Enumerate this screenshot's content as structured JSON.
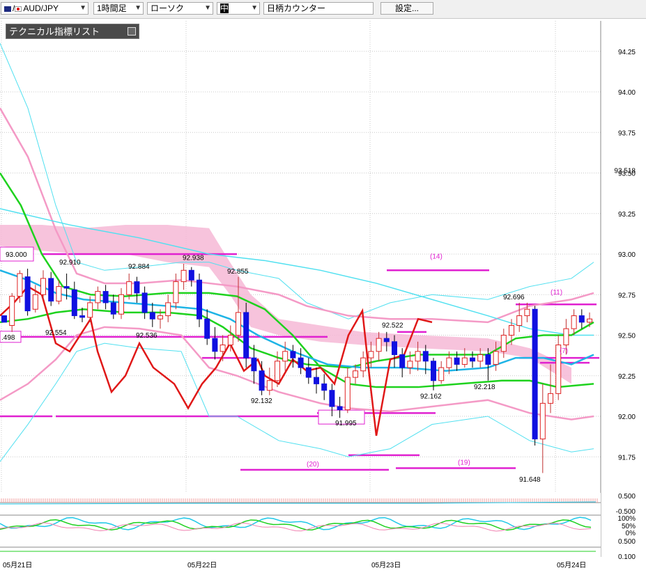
{
  "toolbar": {
    "symbol": "AUD/JPY",
    "timeframe": "1時間足",
    "chart_type": "ローソク",
    "style": "中",
    "counter_placeholder": "日柄カウンター",
    "settings_label": "設定..."
  },
  "indicator_panel": {
    "label": "テクニカル指標リスト"
  },
  "colors": {
    "bull_candle": "#e02020",
    "bear_candle": "#1010e0",
    "ichimoku_cloud": "#f6b8d6",
    "bollinger_inner": "#f49ac6",
    "bollinger_outer": "#50e0f0",
    "moving_average_green": "#1ed21e",
    "moving_average_blue": "#1eb4e6",
    "red_line": "#e01818",
    "support_resistance": "#e020d0"
  },
  "chart_data": {
    "type": "candlestick",
    "ylim": [
      91.55,
      94.32
    ],
    "y_ticks": [
      "94.25",
      "94.00",
      "93.75",
      "93.50",
      "93.25",
      "93.00",
      "92.75",
      "92.50",
      "92.25",
      "92.00",
      "91.75"
    ],
    "current_price_label": "93.518",
    "x_ticks": [
      "05月21日",
      "05月22日",
      "05月23日",
      "05月24日"
    ],
    "candles": [
      [
        92.62,
        92.58,
        92.55,
        92.55
      ],
      [
        92.56,
        92.74,
        92.76,
        92.52
      ],
      [
        92.74,
        92.88,
        92.9,
        92.7
      ],
      [
        92.86,
        92.65,
        92.91,
        92.62
      ],
      [
        92.66,
        92.75,
        92.81,
        92.64
      ],
      [
        92.75,
        92.85,
        92.9,
        92.72
      ],
      [
        92.85,
        92.71,
        92.89,
        92.68
      ],
      [
        92.71,
        92.8,
        92.84,
        92.69
      ],
      [
        92.8,
        92.79,
        92.88,
        92.72
      ],
      [
        92.78,
        92.62,
        92.83,
        92.6
      ],
      [
        92.62,
        92.61,
        92.67,
        92.58
      ],
      [
        92.61,
        92.7,
        92.74,
        92.58
      ],
      [
        92.7,
        92.77,
        92.8,
        92.66
      ],
      [
        92.77,
        92.7,
        92.81,
        92.66
      ],
      [
        92.7,
        92.63,
        92.75,
        92.6
      ],
      [
        92.63,
        92.75,
        92.79,
        92.6
      ],
      [
        92.75,
        92.83,
        92.88,
        92.72
      ],
      [
        92.83,
        92.76,
        92.86,
        92.7
      ],
      [
        92.76,
        92.64,
        92.8,
        92.6
      ],
      [
        92.64,
        92.6,
        92.7,
        92.55
      ],
      [
        92.6,
        92.62,
        92.66,
        92.54
      ],
      [
        92.62,
        92.7,
        92.75,
        92.58
      ],
      [
        92.7,
        92.83,
        92.88,
        92.66
      ],
      [
        92.83,
        92.9,
        92.94,
        92.78
      ],
      [
        92.9,
        92.84,
        92.92,
        92.8
      ],
      [
        92.84,
        92.6,
        92.88,
        92.55
      ],
      [
        92.6,
        92.48,
        92.66,
        92.44
      ],
      [
        92.48,
        92.4,
        92.55,
        92.35
      ],
      [
        92.4,
        92.44,
        92.5,
        92.34
      ],
      [
        92.44,
        92.5,
        92.56,
        92.4
      ],
      [
        92.5,
        92.64,
        92.86,
        92.46
      ],
      [
        92.64,
        92.36,
        92.7,
        92.3
      ],
      [
        92.36,
        92.28,
        92.44,
        92.2
      ],
      [
        92.28,
        92.16,
        92.34,
        92.13
      ],
      [
        92.16,
        92.22,
        92.3,
        92.13
      ],
      [
        92.22,
        92.34,
        92.4,
        92.18
      ],
      [
        92.34,
        92.4,
        92.46,
        92.28
      ],
      [
        92.4,
        92.36,
        92.44,
        92.3
      ],
      [
        92.36,
        92.3,
        92.42,
        92.26
      ],
      [
        92.3,
        92.24,
        92.36,
        92.2
      ],
      [
        92.24,
        92.2,
        92.3,
        92.14
      ],
      [
        92.2,
        92.16,
        92.26,
        92.1
      ],
      [
        92.16,
        92.06,
        92.2,
        92.0
      ],
      [
        92.06,
        92.04,
        92.12,
        91.99
      ],
      [
        92.04,
        92.24,
        92.3,
        92.02
      ],
      [
        92.24,
        92.28,
        92.32,
        92.2
      ],
      [
        92.28,
        92.36,
        92.4,
        92.24
      ],
      [
        92.36,
        92.4,
        92.46,
        92.3
      ],
      [
        92.4,
        92.48,
        92.52,
        92.34
      ],
      [
        92.48,
        92.46,
        92.52,
        92.4
      ],
      [
        92.46,
        92.38,
        92.5,
        92.3
      ],
      [
        92.38,
        92.3,
        92.42,
        92.24
      ],
      [
        92.3,
        92.34,
        92.4,
        92.26
      ],
      [
        92.34,
        92.4,
        92.46,
        92.28
      ],
      [
        92.4,
        92.34,
        92.44,
        92.26
      ],
      [
        92.34,
        92.22,
        92.36,
        92.16
      ],
      [
        92.22,
        92.3,
        92.34,
        92.2
      ],
      [
        92.3,
        92.36,
        92.4,
        92.26
      ],
      [
        92.36,
        92.32,
        92.4,
        92.28
      ],
      [
        92.32,
        92.36,
        92.42,
        92.3
      ],
      [
        92.36,
        92.34,
        92.4,
        92.3
      ],
      [
        92.34,
        92.38,
        92.42,
        92.3
      ],
      [
        92.38,
        92.32,
        92.42,
        92.22
      ],
      [
        92.32,
        92.4,
        92.46,
        92.28
      ],
      [
        92.4,
        92.5,
        92.54,
        92.36
      ],
      [
        92.5,
        92.56,
        92.6,
        92.44
      ],
      [
        92.56,
        92.62,
        92.7,
        92.52
      ],
      [
        92.62,
        92.66,
        92.7,
        92.58
      ],
      [
        92.66,
        91.86,
        92.68,
        91.82
      ],
      [
        91.86,
        92.08,
        92.2,
        91.65
      ],
      [
        92.08,
        92.14,
        92.32,
        92.02
      ],
      [
        92.14,
        92.44,
        92.5,
        92.1
      ],
      [
        92.44,
        92.54,
        92.6,
        92.38
      ],
      [
        92.54,
        92.62,
        92.66,
        92.5
      ],
      [
        92.62,
        92.58,
        92.66,
        92.54
      ],
      [
        92.58,
        92.6,
        92.64,
        92.55
      ]
    ],
    "high_low_labels": [
      "93.000",
      "92.910",
      "92.884",
      "92.938",
      "92.855",
      "92.554",
      "92.536",
      "92.132",
      "91.995",
      "92.522",
      "92.162",
      "92.218",
      "92.696",
      "91.648",
      ".498"
    ],
    "cycle_counts": [
      "(14)",
      "(20)",
      "(19)",
      "(11)",
      "(7)"
    ],
    "oscillator_axis": [
      "0.500",
      "-0.500",
      "100%",
      "50%",
      "0%",
      "0.500",
      "0.100"
    ]
  }
}
